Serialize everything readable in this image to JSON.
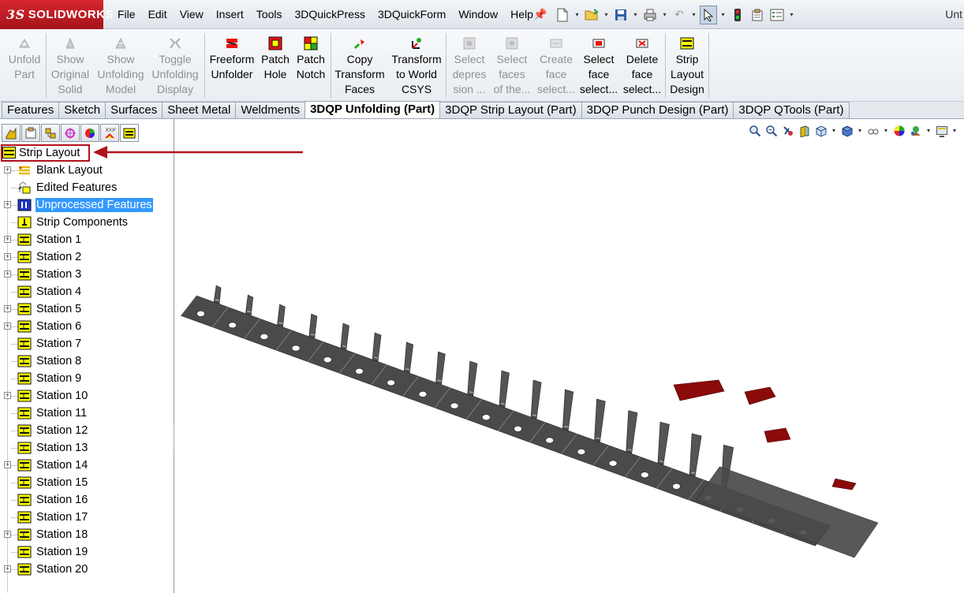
{
  "app": {
    "logo": "SOLIDWORKS",
    "logo_prefix": "3S",
    "document_title": "Unt"
  },
  "menus": [
    "File",
    "Edit",
    "View",
    "Insert",
    "Tools",
    "3DQuickPress",
    "3DQuickForm",
    "Window",
    "Help"
  ],
  "ribbon": {
    "buttons": [
      {
        "label": "Unfold\nPart",
        "enabled": false
      },
      {
        "label": "Show\nOriginal\nSolid",
        "enabled": false
      },
      {
        "label": "Show\nUnfolding\nModel",
        "enabled": false
      },
      {
        "label": "Toggle\nUnfolding\nDisplay",
        "enabled": false
      },
      {
        "label": "Freeform\nUnfolder",
        "enabled": true
      },
      {
        "label": "Patch\nHole",
        "enabled": true
      },
      {
        "label": "Patch\nNotch",
        "enabled": true
      },
      {
        "label": "Copy\nTransform\nFaces",
        "enabled": true
      },
      {
        "label": "Transform\nto World\nCSYS",
        "enabled": true
      },
      {
        "label": "Select\ndepres\nsion ...",
        "enabled": false
      },
      {
        "label": "Select\nfaces\nof the...",
        "enabled": false
      },
      {
        "label": "Create\nface\nselect...",
        "enabled": false
      },
      {
        "label": "Select\nface\nselect...",
        "enabled": true
      },
      {
        "label": "Delete\nface\nselect...",
        "enabled": true
      },
      {
        "label": "Strip\nLayout\nDesign",
        "enabled": true
      }
    ]
  },
  "tabs": [
    {
      "label": "Features",
      "active": false
    },
    {
      "label": "Sketch",
      "active": false
    },
    {
      "label": "Surfaces",
      "active": false
    },
    {
      "label": "Sheet Metal",
      "active": false
    },
    {
      "label": "Weldments",
      "active": false
    },
    {
      "label": "3DQP Unfolding (Part)",
      "active": true
    },
    {
      "label": "3DQP Strip Layout (Part)",
      "active": false
    },
    {
      "label": "3DQP Punch Design (Part)",
      "active": false
    },
    {
      "label": "3DQP QTools (Part)",
      "active": false
    }
  ],
  "tree": {
    "root": "Strip Layout",
    "items": [
      {
        "label": "Blank Layout",
        "expandable": true,
        "icon": "blank-layout-icon",
        "selected": false
      },
      {
        "label": "Edited Features",
        "expandable": false,
        "icon": "edited-features-icon",
        "selected": false
      },
      {
        "label": "Unprocessed Features",
        "expandable": true,
        "icon": "unprocessed-features-icon",
        "selected": true
      },
      {
        "label": "Strip Components",
        "expandable": false,
        "icon": "strip-components-icon",
        "selected": false
      },
      {
        "label": "Station 1",
        "expandable": true,
        "icon": "station-icon",
        "selected": false
      },
      {
        "label": "Station 2",
        "expandable": true,
        "icon": "station-icon",
        "selected": false
      },
      {
        "label": "Station 3",
        "expandable": true,
        "icon": "station-icon",
        "selected": false
      },
      {
        "label": "Station 4",
        "expandable": false,
        "icon": "station-icon",
        "selected": false
      },
      {
        "label": "Station 5",
        "expandable": true,
        "icon": "station-icon",
        "selected": false
      },
      {
        "label": "Station 6",
        "expandable": true,
        "icon": "station-icon",
        "selected": false
      },
      {
        "label": "Station 7",
        "expandable": false,
        "icon": "station-icon",
        "selected": false
      },
      {
        "label": "Station 8",
        "expandable": false,
        "icon": "station-icon",
        "selected": false
      },
      {
        "label": "Station 9",
        "expandable": false,
        "icon": "station-icon",
        "selected": false
      },
      {
        "label": "Station 10",
        "expandable": true,
        "icon": "station-icon",
        "selected": false
      },
      {
        "label": "Station 11",
        "expandable": false,
        "icon": "station-icon",
        "selected": false
      },
      {
        "label": "Station 12",
        "expandable": false,
        "icon": "station-icon",
        "selected": false
      },
      {
        "label": "Station 13",
        "expandable": false,
        "icon": "station-icon",
        "selected": false
      },
      {
        "label": "Station 14",
        "expandable": true,
        "icon": "station-icon",
        "selected": false
      },
      {
        "label": "Station 15",
        "expandable": false,
        "icon": "station-icon",
        "selected": false
      },
      {
        "label": "Station 16",
        "expandable": false,
        "icon": "station-icon",
        "selected": false
      },
      {
        "label": "Station 17",
        "expandable": false,
        "icon": "station-icon",
        "selected": false
      },
      {
        "label": "Station 18",
        "expandable": true,
        "icon": "station-icon",
        "selected": false
      },
      {
        "label": "Station 19",
        "expandable": false,
        "icon": "station-icon",
        "selected": false
      },
      {
        "label": "Station 20",
        "expandable": true,
        "icon": "station-icon",
        "selected": false
      }
    ]
  },
  "colors": {
    "selection": "#3399ff",
    "highlight_box": "#b2121b",
    "strip_metal": "#4a4a4a",
    "strip_punched": "#8b0a0a"
  }
}
